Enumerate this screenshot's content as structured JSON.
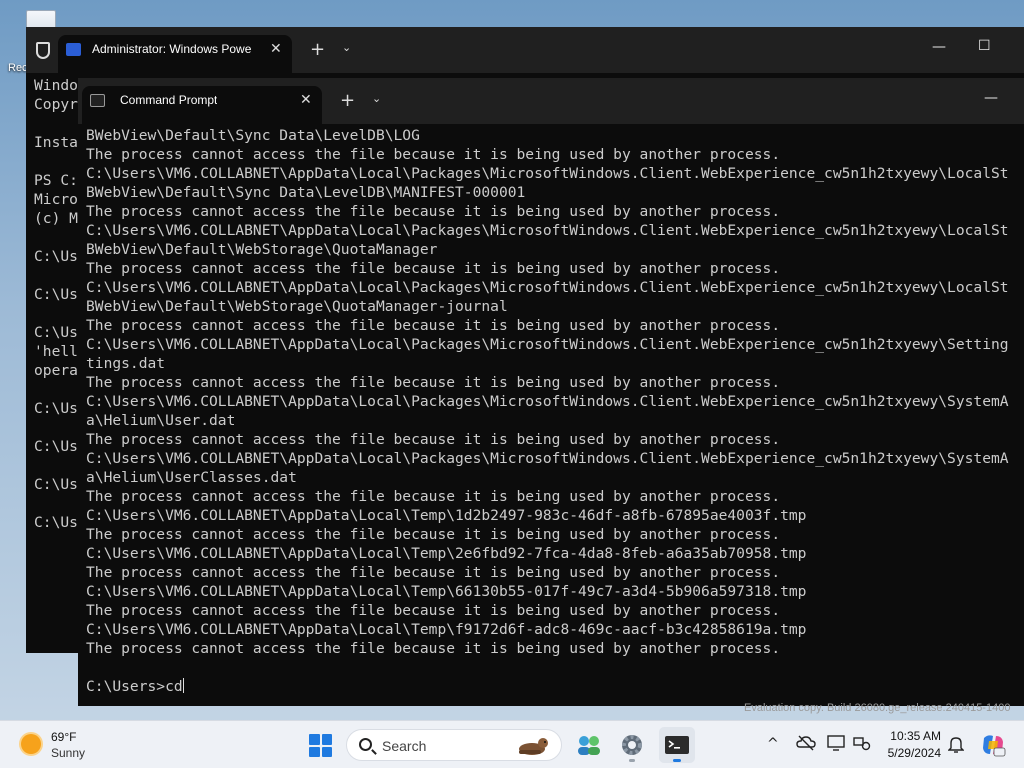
{
  "desktop": {
    "recycle_bin_label": "Rec"
  },
  "powershell_window": {
    "tab_title": "Administrator: Windows Powe",
    "tab_close": "✕",
    "new_tab": "+",
    "dropdown": "⌄",
    "minimize": "—",
    "maximize": "☐",
    "lines": [
      "Windo",
      "Copyr",
      "",
      "Insta",
      "",
      "PS C:",
      "Micro",
      "(c) M",
      "",
      "C:\\Us",
      "",
      "C:\\Us",
      "",
      "C:\\Us",
      "'hell",
      "opera",
      "",
      "C:\\Us",
      "",
      "C:\\Us",
      "",
      "C:\\Us",
      "",
      "C:\\Us"
    ]
  },
  "cmd_window": {
    "tab_title": "Command Prompt",
    "tab_close": "✕",
    "new_tab": "+",
    "dropdown": "⌄",
    "minimize": "—",
    "lines": [
      "BWebView\\Default\\Sync Data\\LevelDB\\LOG",
      "The process cannot access the file because it is being used by another process.",
      "C:\\Users\\VM6.COLLABNET\\AppData\\Local\\Packages\\MicrosoftWindows.Client.WebExperience_cw5n1h2txyewy\\LocalSt",
      "BWebView\\Default\\Sync Data\\LevelDB\\MANIFEST-000001",
      "The process cannot access the file because it is being used by another process.",
      "C:\\Users\\VM6.COLLABNET\\AppData\\Local\\Packages\\MicrosoftWindows.Client.WebExperience_cw5n1h2txyewy\\LocalSt",
      "BWebView\\Default\\WebStorage\\QuotaManager",
      "The process cannot access the file because it is being used by another process.",
      "C:\\Users\\VM6.COLLABNET\\AppData\\Local\\Packages\\MicrosoftWindows.Client.WebExperience_cw5n1h2txyewy\\LocalSt",
      "BWebView\\Default\\WebStorage\\QuotaManager-journal",
      "The process cannot access the file because it is being used by another process.",
      "C:\\Users\\VM6.COLLABNET\\AppData\\Local\\Packages\\MicrosoftWindows.Client.WebExperience_cw5n1h2txyewy\\Setting",
      "tings.dat",
      "The process cannot access the file because it is being used by another process.",
      "C:\\Users\\VM6.COLLABNET\\AppData\\Local\\Packages\\MicrosoftWindows.Client.WebExperience_cw5n1h2txyewy\\SystemA",
      "a\\Helium\\User.dat",
      "The process cannot access the file because it is being used by another process.",
      "C:\\Users\\VM6.COLLABNET\\AppData\\Local\\Packages\\MicrosoftWindows.Client.WebExperience_cw5n1h2txyewy\\SystemA",
      "a\\Helium\\UserClasses.dat",
      "The process cannot access the file because it is being used by another process.",
      "C:\\Users\\VM6.COLLABNET\\AppData\\Local\\Temp\\1d2b2497-983c-46df-a8fb-67895ae4003f.tmp",
      "The process cannot access the file because it is being used by another process.",
      "C:\\Users\\VM6.COLLABNET\\AppData\\Local\\Temp\\2e6fbd92-7fca-4da8-8feb-a6a35ab70958.tmp",
      "The process cannot access the file because it is being used by another process.",
      "C:\\Users\\VM6.COLLABNET\\AppData\\Local\\Temp\\66130b55-017f-49c7-a3d4-5b906a597318.tmp",
      "The process cannot access the file because it is being used by another process.",
      "C:\\Users\\VM6.COLLABNET\\AppData\\Local\\Temp\\f9172d6f-adc8-469c-aacf-b3c42858619a.tmp",
      "The process cannot access the file because it is being used by another process.",
      ""
    ],
    "prompt": "C:\\Users>cd"
  },
  "watermark": "Evaluation copy. Build 26080.ge_release.240415-1400",
  "taskbar": {
    "weather_temp": "69°F",
    "weather_condition": "Sunny",
    "search_label": "Search",
    "tray_chevron": "^",
    "clock_time": "10:35 AM",
    "clock_date": "5/29/2024"
  }
}
